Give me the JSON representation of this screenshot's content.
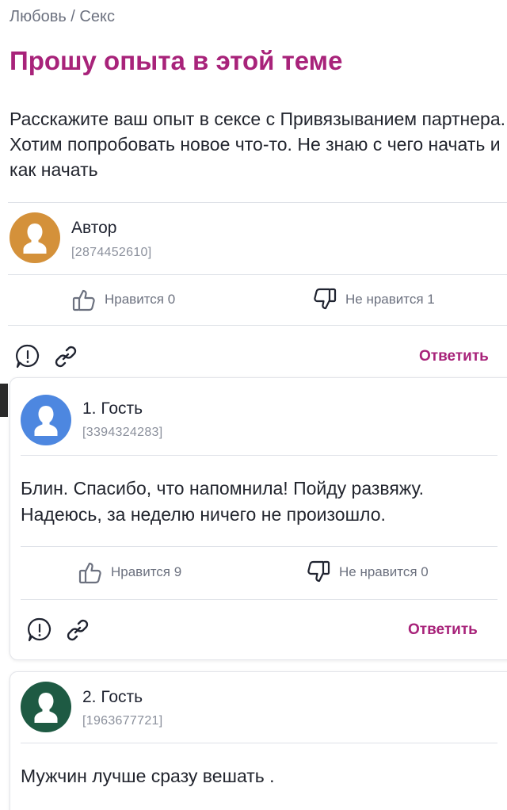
{
  "breadcrumb": "Любовь / Секс",
  "post": {
    "title": "Прошу опыта в этой теме",
    "text": "Расскажите ваш опыт в сексе с Привязыванием партнера. Хотим попробовать новое что-то. Не знаю с чего начать и как начать",
    "author_name": "Автор",
    "author_id": "[2874452610]",
    "avatar_color": "#d4913a",
    "like_label": "Нравится 0",
    "dislike_label": "Не нравится 1",
    "reply_label": "Ответить"
  },
  "comments": [
    {
      "name": "1. Гость",
      "id": "[3394324283]",
      "avatar_color": "#4d87e0",
      "text": "Блин. Спасибо, что напомнила! Пойду развяжу. Надеюсь, за неделю ничего не произошло.",
      "like_label": "Нравится 9",
      "dislike_label": "Не нравится 0",
      "reply_label": "Ответить"
    },
    {
      "name": "2. Гость",
      "id": "[1963677721]",
      "avatar_color": "#1e5a43",
      "text": "Мужчин лучше сразу вешать ."
    }
  ],
  "icons": {
    "like": "thumbs-up-icon",
    "dislike": "thumbs-down-icon",
    "report": "exclamation-circle-icon",
    "link": "link-icon",
    "avatar": "user-silhouette-icon"
  },
  "colors": {
    "accent": "#a8237a",
    "muted_text": "#6c717f"
  }
}
